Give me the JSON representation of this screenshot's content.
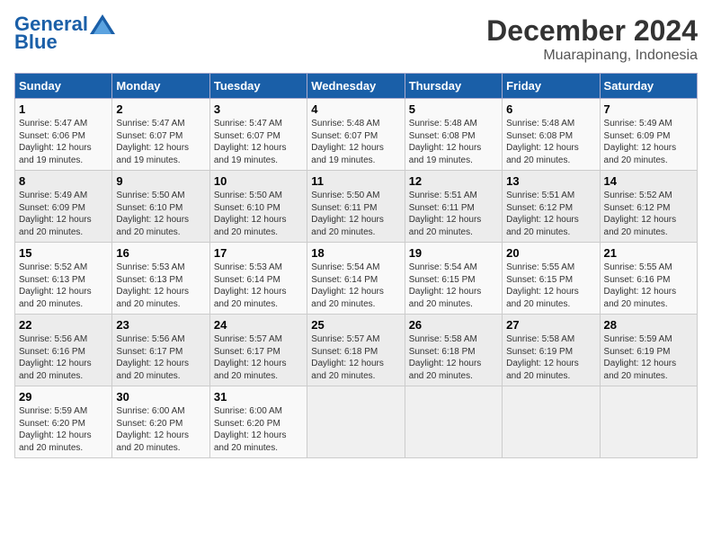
{
  "header": {
    "logo_line1": "General",
    "logo_line2": "Blue",
    "title": "December 2024",
    "subtitle": "Muarapinang, Indonesia"
  },
  "calendar": {
    "days_of_week": [
      "Sunday",
      "Monday",
      "Tuesday",
      "Wednesday",
      "Thursday",
      "Friday",
      "Saturday"
    ],
    "weeks": [
      [
        {
          "day": "1",
          "rise": "Sunrise: 5:47 AM",
          "set": "Sunset: 6:06 PM",
          "daylight": "Daylight: 12 hours and 19 minutes."
        },
        {
          "day": "2",
          "rise": "Sunrise: 5:47 AM",
          "set": "Sunset: 6:07 PM",
          "daylight": "Daylight: 12 hours and 19 minutes."
        },
        {
          "day": "3",
          "rise": "Sunrise: 5:47 AM",
          "set": "Sunset: 6:07 PM",
          "daylight": "Daylight: 12 hours and 19 minutes."
        },
        {
          "day": "4",
          "rise": "Sunrise: 5:48 AM",
          "set": "Sunset: 6:07 PM",
          "daylight": "Daylight: 12 hours and 19 minutes."
        },
        {
          "day": "5",
          "rise": "Sunrise: 5:48 AM",
          "set": "Sunset: 6:08 PM",
          "daylight": "Daylight: 12 hours and 19 minutes."
        },
        {
          "day": "6",
          "rise": "Sunrise: 5:48 AM",
          "set": "Sunset: 6:08 PM",
          "daylight": "Daylight: 12 hours and 20 minutes."
        },
        {
          "day": "7",
          "rise": "Sunrise: 5:49 AM",
          "set": "Sunset: 6:09 PM",
          "daylight": "Daylight: 12 hours and 20 minutes."
        }
      ],
      [
        {
          "day": "8",
          "rise": "Sunrise: 5:49 AM",
          "set": "Sunset: 6:09 PM",
          "daylight": "Daylight: 12 hours and 20 minutes."
        },
        {
          "day": "9",
          "rise": "Sunrise: 5:50 AM",
          "set": "Sunset: 6:10 PM",
          "daylight": "Daylight: 12 hours and 20 minutes."
        },
        {
          "day": "10",
          "rise": "Sunrise: 5:50 AM",
          "set": "Sunset: 6:10 PM",
          "daylight": "Daylight: 12 hours and 20 minutes."
        },
        {
          "day": "11",
          "rise": "Sunrise: 5:50 AM",
          "set": "Sunset: 6:11 PM",
          "daylight": "Daylight: 12 hours and 20 minutes."
        },
        {
          "day": "12",
          "rise": "Sunrise: 5:51 AM",
          "set": "Sunset: 6:11 PM",
          "daylight": "Daylight: 12 hours and 20 minutes."
        },
        {
          "day": "13",
          "rise": "Sunrise: 5:51 AM",
          "set": "Sunset: 6:12 PM",
          "daylight": "Daylight: 12 hours and 20 minutes."
        },
        {
          "day": "14",
          "rise": "Sunrise: 5:52 AM",
          "set": "Sunset: 6:12 PM",
          "daylight": "Daylight: 12 hours and 20 minutes."
        }
      ],
      [
        {
          "day": "15",
          "rise": "Sunrise: 5:52 AM",
          "set": "Sunset: 6:13 PM",
          "daylight": "Daylight: 12 hours and 20 minutes."
        },
        {
          "day": "16",
          "rise": "Sunrise: 5:53 AM",
          "set": "Sunset: 6:13 PM",
          "daylight": "Daylight: 12 hours and 20 minutes."
        },
        {
          "day": "17",
          "rise": "Sunrise: 5:53 AM",
          "set": "Sunset: 6:14 PM",
          "daylight": "Daylight: 12 hours and 20 minutes."
        },
        {
          "day": "18",
          "rise": "Sunrise: 5:54 AM",
          "set": "Sunset: 6:14 PM",
          "daylight": "Daylight: 12 hours and 20 minutes."
        },
        {
          "day": "19",
          "rise": "Sunrise: 5:54 AM",
          "set": "Sunset: 6:15 PM",
          "daylight": "Daylight: 12 hours and 20 minutes."
        },
        {
          "day": "20",
          "rise": "Sunrise: 5:55 AM",
          "set": "Sunset: 6:15 PM",
          "daylight": "Daylight: 12 hours and 20 minutes."
        },
        {
          "day": "21",
          "rise": "Sunrise: 5:55 AM",
          "set": "Sunset: 6:16 PM",
          "daylight": "Daylight: 12 hours and 20 minutes."
        }
      ],
      [
        {
          "day": "22",
          "rise": "Sunrise: 5:56 AM",
          "set": "Sunset: 6:16 PM",
          "daylight": "Daylight: 12 hours and 20 minutes."
        },
        {
          "day": "23",
          "rise": "Sunrise: 5:56 AM",
          "set": "Sunset: 6:17 PM",
          "daylight": "Daylight: 12 hours and 20 minutes."
        },
        {
          "day": "24",
          "rise": "Sunrise: 5:57 AM",
          "set": "Sunset: 6:17 PM",
          "daylight": "Daylight: 12 hours and 20 minutes."
        },
        {
          "day": "25",
          "rise": "Sunrise: 5:57 AM",
          "set": "Sunset: 6:18 PM",
          "daylight": "Daylight: 12 hours and 20 minutes."
        },
        {
          "day": "26",
          "rise": "Sunrise: 5:58 AM",
          "set": "Sunset: 6:18 PM",
          "daylight": "Daylight: 12 hours and 20 minutes."
        },
        {
          "day": "27",
          "rise": "Sunrise: 5:58 AM",
          "set": "Sunset: 6:19 PM",
          "daylight": "Daylight: 12 hours and 20 minutes."
        },
        {
          "day": "28",
          "rise": "Sunrise: 5:59 AM",
          "set": "Sunset: 6:19 PM",
          "daylight": "Daylight: 12 hours and 20 minutes."
        }
      ],
      [
        {
          "day": "29",
          "rise": "Sunrise: 5:59 AM",
          "set": "Sunset: 6:20 PM",
          "daylight": "Daylight: 12 hours and 20 minutes."
        },
        {
          "day": "30",
          "rise": "Sunrise: 6:00 AM",
          "set": "Sunset: 6:20 PM",
          "daylight": "Daylight: 12 hours and 20 minutes."
        },
        {
          "day": "31",
          "rise": "Sunrise: 6:00 AM",
          "set": "Sunset: 6:20 PM",
          "daylight": "Daylight: 12 hours and 20 minutes."
        },
        null,
        null,
        null,
        null
      ]
    ]
  }
}
